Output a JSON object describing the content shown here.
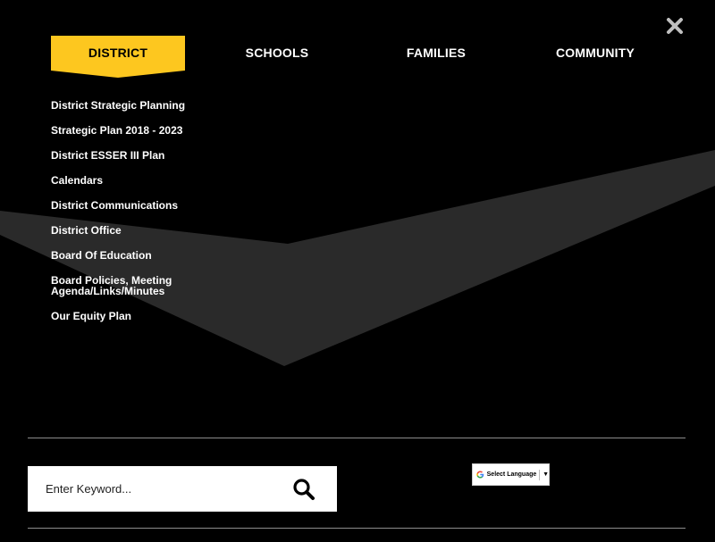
{
  "nav": {
    "tabs": [
      {
        "label": "DISTRICT",
        "active": true
      },
      {
        "label": "SCHOOLS",
        "active": false
      },
      {
        "label": "FAMILIES",
        "active": false
      },
      {
        "label": "COMMUNITY",
        "active": false
      }
    ]
  },
  "menu": {
    "items": [
      "District Strategic Planning",
      "Strategic Plan 2018 - 2023",
      "District ESSER III Plan",
      "Calendars",
      "District Communications",
      "District Office",
      "Board Of Education",
      "Board Policies, Meeting Agenda/Links/Minutes",
      "Our Equity Plan"
    ]
  },
  "search": {
    "placeholder": "Enter Keyword..."
  },
  "language": {
    "label": "Select Language",
    "arrow": "▼"
  },
  "icons": {
    "close": "close-icon",
    "search": "search-icon",
    "google": "google-g-icon"
  },
  "colors": {
    "background": "#000000",
    "accent": "#fdc71f",
    "text": "#ffffff",
    "divider": "#8c8c8c"
  }
}
